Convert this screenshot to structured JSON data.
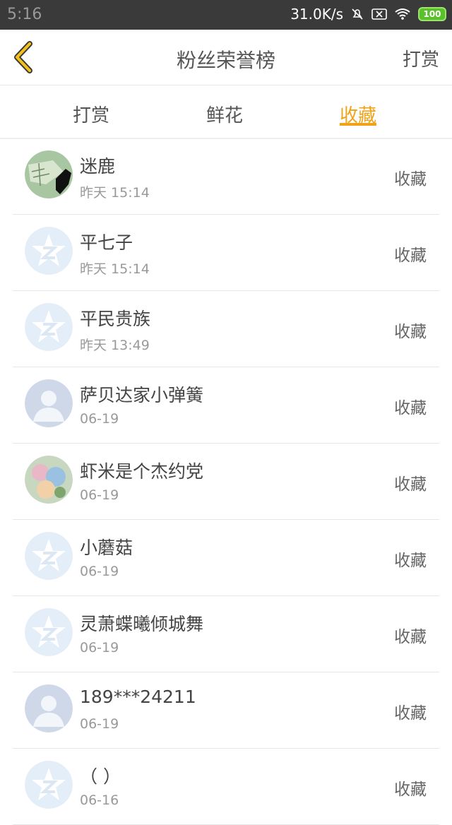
{
  "status_bar": {
    "time": "5:16",
    "speed": "31.0K/s",
    "battery": "100"
  },
  "header": {
    "title": "粉丝荣誉榜",
    "action": "打赏"
  },
  "tabs": [
    {
      "label": "打赏"
    },
    {
      "label": "鲜花"
    },
    {
      "label": "收藏",
      "active": true
    }
  ],
  "rows": [
    {
      "name": "迷鹿",
      "time": "昨天 15:14",
      "action": "收藏",
      "avatar": "photo-map"
    },
    {
      "name": "平七子",
      "time": "昨天 15:14",
      "action": "收藏",
      "avatar": "qzone-star"
    },
    {
      "name": "平民贵族",
      "time": "昨天 13:49",
      "action": "收藏",
      "avatar": "qzone-star"
    },
    {
      "name": "萨贝达家小弹簧",
      "time": "06-19",
      "action": "收藏",
      "avatar": "default-person"
    },
    {
      "name": "虾米是个杰约党",
      "time": "06-19",
      "action": "收藏",
      "avatar": "photo-anime"
    },
    {
      "name": "小蘑菇",
      "time": "06-19",
      "action": "收藏",
      "avatar": "qzone-star"
    },
    {
      "name": "灵萧蝶曦倾城舞",
      "time": "06-19",
      "action": "收藏",
      "avatar": "qzone-star"
    },
    {
      "name": "189***24211",
      "time": "06-19",
      "action": "收藏",
      "avatar": "default-person"
    },
    {
      "name": "（ ）",
      "time": "06-16",
      "action": "收藏",
      "avatar": "qzone-star"
    }
  ],
  "colors": {
    "accent": "#f0a318",
    "statusbar": "#3a3a3a"
  }
}
